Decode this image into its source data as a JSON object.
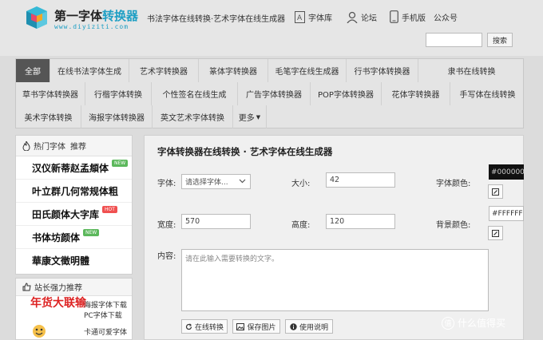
{
  "header": {
    "logo_title_prefix": "第一字体",
    "logo_title_highlight": "转换器",
    "logo_url": "www.diyiziti.com",
    "tagline": "书法字体在线转换·艺术字体在线生成器",
    "nav": [
      {
        "label": "字体库",
        "icon": "font-library-icon"
      },
      {
        "label": "论坛",
        "icon": "user-icon"
      },
      {
        "label": "手机版",
        "icon": "mobile-icon"
      },
      {
        "label": "公众号",
        "icon": ""
      }
    ],
    "search_placeholder": "",
    "search_button": "搜索"
  },
  "categories": {
    "row1": [
      "全部",
      "在线书法字体生成",
      "艺术字转换器",
      "篆体字转换器",
      "毛笔字在线生成器",
      "行书字体转换器",
      "隶书在线转换"
    ],
    "row2": [
      "草书字体转换器",
      "行楷字体转换",
      "个性签名在线生成",
      "广告字体转换器",
      "POP字体转换器",
      "花体字转换器",
      "手写体在线转换"
    ],
    "row3": [
      "美术字体转换",
      "海报字体转换器",
      "英文艺术字体转换",
      "更多"
    ],
    "active": "全部"
  },
  "sidebar": {
    "hot_title": "热门字体",
    "hot_sub": "推荐",
    "hot_fonts": [
      {
        "name": "汉仪新蒂赵孟頫体",
        "badge": "NEW"
      },
      {
        "name": "叶立群几何常规体粗",
        "badge": ""
      },
      {
        "name": "田氏颜体大字库",
        "badge": "HOT"
      },
      {
        "name": "书体坊颜体",
        "badge": "NEW"
      },
      {
        "name": "華康文徵明體",
        "badge": ""
      }
    ],
    "promo_title": "站长强力推荐",
    "promos": [
      {
        "image_text": "年货大联输",
        "link1": "海报字体下载",
        "link2": "PC字体下载"
      },
      {
        "image_text": "",
        "link1": "卡通可爱字体",
        "link2": ""
      }
    ]
  },
  "main": {
    "title": "字体转换器在线转换 · 艺术字体在线生成器",
    "font_label": "字体:",
    "font_select": "请选择字体...",
    "size_label": "大小:",
    "size_value": "42",
    "color_label": "字体颜色:",
    "color_value": "#000000",
    "width_label": "宽度:",
    "width_value": "570",
    "height_label": "高度:",
    "height_value": "120",
    "bg_label": "背景颜色:",
    "bg_value": "#FFFFFF",
    "content_label": "内容:",
    "content_placeholder": "请在此输入需要转换的文字。",
    "buttons": {
      "convert": "在线转换",
      "save": "保存图片",
      "help": "使用说明"
    }
  },
  "watermark": {
    "icon_text": "值",
    "text": "什么值得买"
  },
  "colors": {
    "accent": "#1f9fc4",
    "active_tab": "#555555",
    "new_badge": "#5cb85c",
    "hot_badge": "#f05050"
  }
}
